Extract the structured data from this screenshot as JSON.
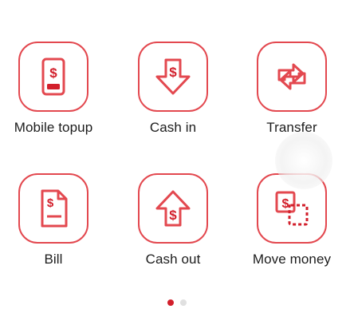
{
  "colors": {
    "accent": "#e3484f",
    "accent_dark": "#d21f2b",
    "text": "#1c1c1c",
    "dot_inactive": "#e0e0e0"
  },
  "actions": [
    {
      "label": "Mobile topup",
      "icon": "mobile-topup-icon"
    },
    {
      "label": "Cash in",
      "icon": "cash-in-icon"
    },
    {
      "label": "Transfer",
      "icon": "transfer-icon"
    },
    {
      "label": "Bill",
      "icon": "bill-icon"
    },
    {
      "label": "Cash out",
      "icon": "cash-out-icon"
    },
    {
      "label": "Move money",
      "icon": "move-money-icon"
    }
  ],
  "pagination": {
    "pages": 2,
    "current": 1
  }
}
